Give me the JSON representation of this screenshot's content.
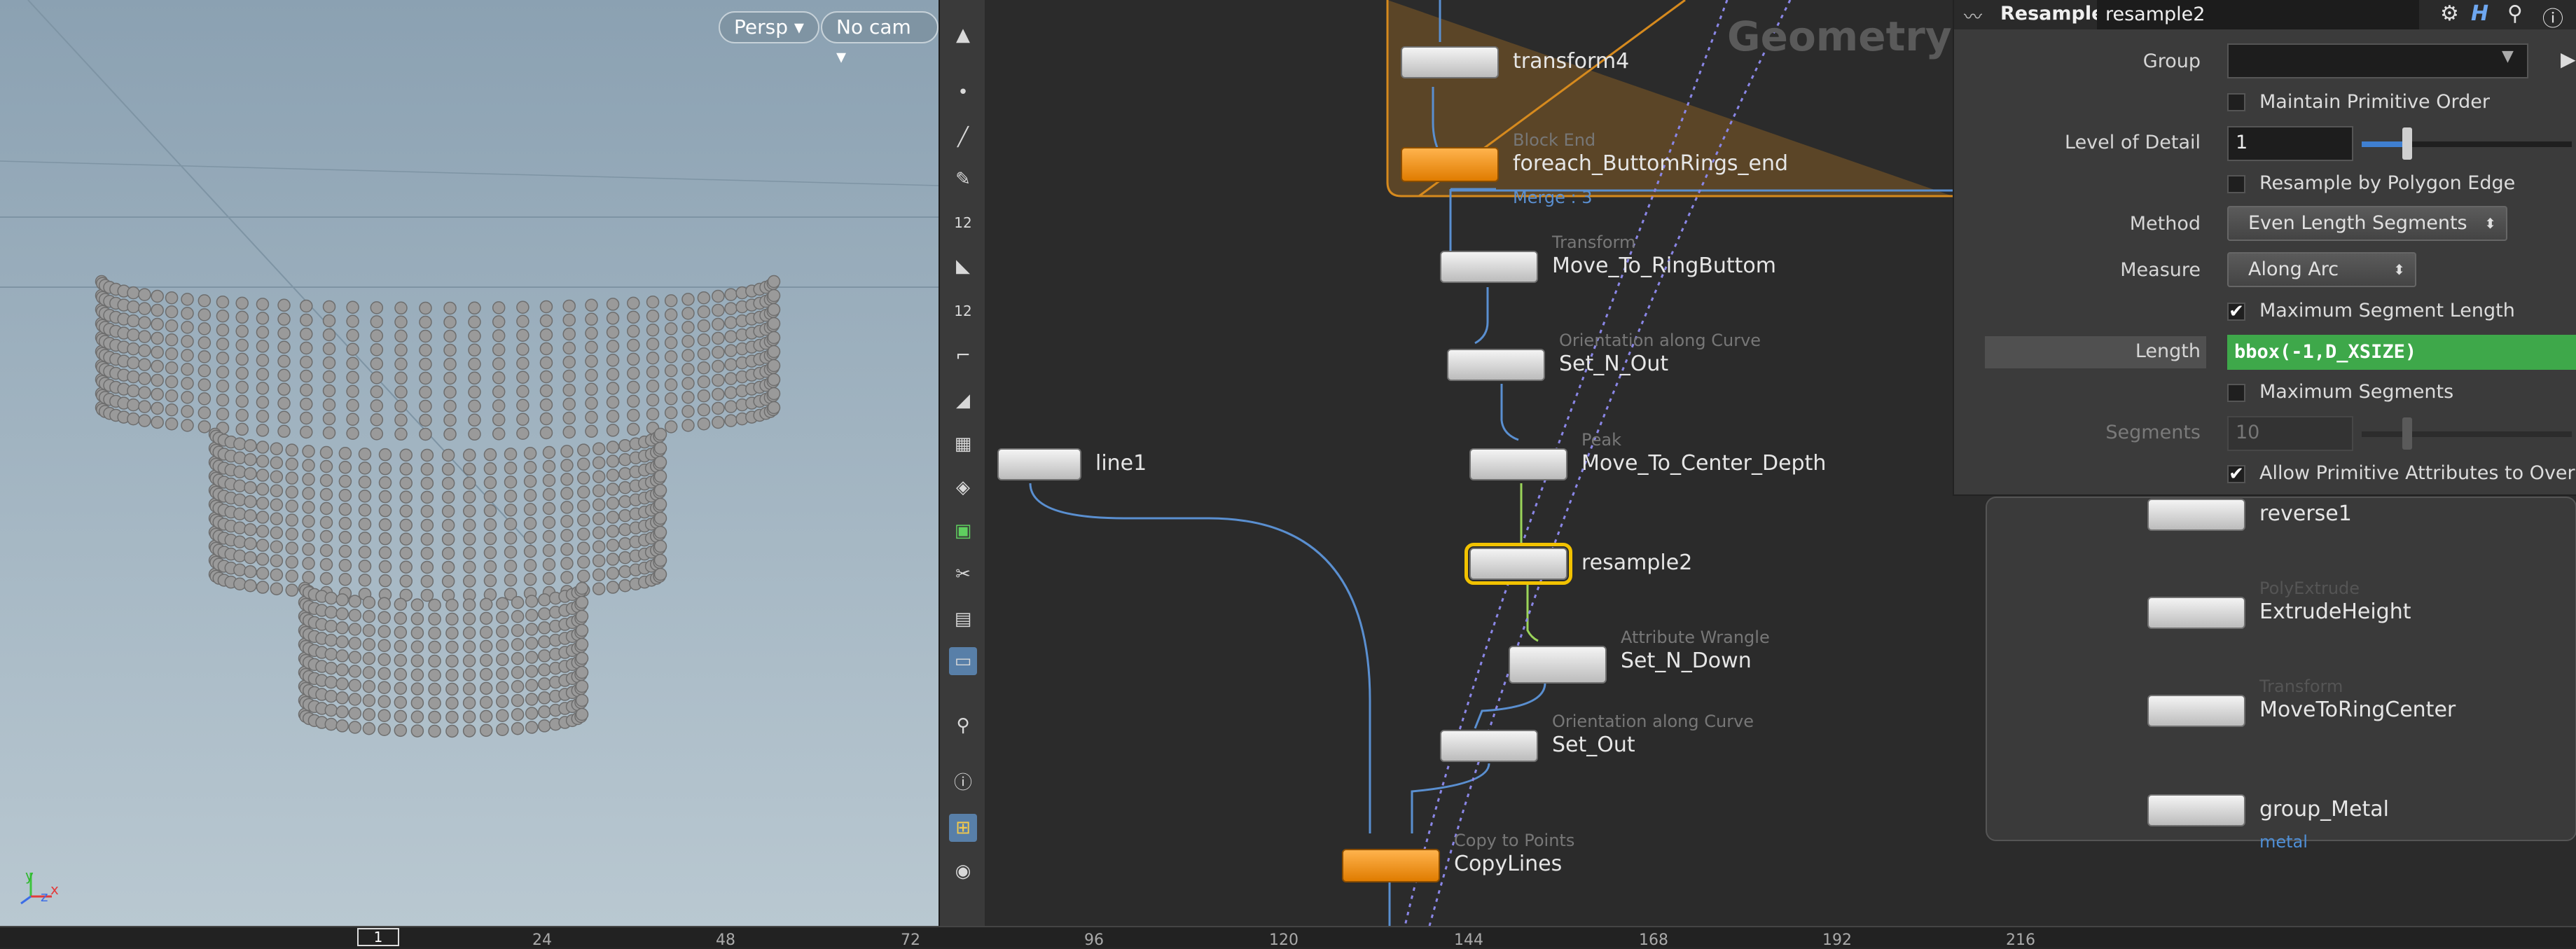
{
  "viewport": {
    "persp_label": "Persp",
    "cam_label": "No cam",
    "axis_x": "x",
    "axis_y": "y",
    "axis_z": "z"
  },
  "viewport_toolbar": {
    "icons": [
      "arrow-up-icon",
      "dot-icon",
      "brush-icon",
      "pen-icon",
      "num-12-icon",
      "sculpt-icon",
      "num-12b-icon",
      "curve-icon",
      "shape-icon",
      "checker-icon",
      "layers-icon",
      "texture-icon",
      "knife-icon",
      "grid-icon",
      "display-icon",
      "pin-icon",
      "info-icon",
      "layout-icon",
      "eye-icon"
    ],
    "num_label_1": "12",
    "num_label_2": "12"
  },
  "network": {
    "context_label": "Geometry",
    "nodes": [
      {
        "name": "transform4",
        "type": ""
      },
      {
        "name": "foreach_ButtomRings_end",
        "type": "Block End",
        "note": "Merge : 3"
      },
      {
        "name": "Move_To_RingButtom",
        "type": "Transform"
      },
      {
        "name": "Set_N_Out",
        "type": "Orientation along Curve"
      },
      {
        "name": "line1",
        "type": ""
      },
      {
        "name": "Move_To_Center_Depth",
        "type": "Peak"
      },
      {
        "name": "resample2",
        "type": ""
      },
      {
        "name": "Set_N_Down",
        "type": "Attribute Wrangle"
      },
      {
        "name": "Set_Out",
        "type": "Orientation along Curve"
      },
      {
        "name": "CopyLines",
        "type": "Copy to Points"
      },
      {
        "name": "reverse1",
        "type": ""
      },
      {
        "name": "ExtrudeHeight",
        "type": "PolyExtrude"
      },
      {
        "name": "MoveToRingCenter",
        "type": "Transform"
      },
      {
        "name": "group_Metal",
        "type": "",
        "note": "metal"
      }
    ]
  },
  "params": {
    "node_type": "Resample",
    "node_name": "resample2",
    "group_label": "Group",
    "group_value": "",
    "maintain_order_label": "Maintain Primitive Order",
    "lod_label": "Level of Detail",
    "lod_value": "1",
    "resample_edge_label": "Resample by Polygon Edge",
    "method_label": "Method",
    "method_value": "Even Length Segments",
    "measure_label": "Measure",
    "measure_value": "Along Arc",
    "max_seg_length_label": "Maximum Segment Length",
    "length_label": "Length",
    "length_value": "bbox(-1,D_XSIZE)",
    "max_segments_label": "Maximum Segments",
    "segments_label": "Segments",
    "segments_value": "10",
    "allow_prim_attrs_label": "Allow Primitive Attributes to Overri..."
  },
  "timeline": {
    "current_frame": "1",
    "ticks": [
      "24",
      "48",
      "72",
      "96",
      "120",
      "144",
      "168",
      "192",
      "216"
    ]
  },
  "colors": {
    "selected_outline": "#f2c200",
    "length_field": "#3ea84a",
    "orange_node": "#f08a00",
    "wire": "#5a8fd0"
  }
}
